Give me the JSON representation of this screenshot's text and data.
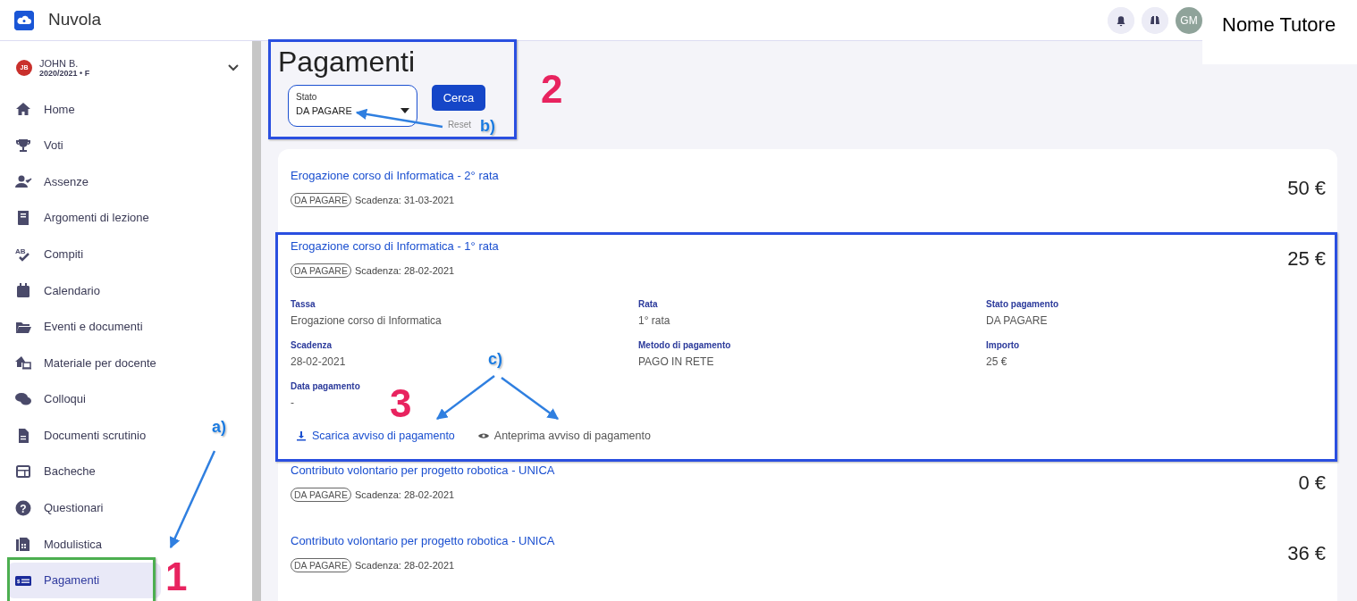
{
  "app": {
    "name": "Nuvola"
  },
  "header": {
    "avatar_initials": "GM",
    "tutor_name": "Nome Tutore"
  },
  "student": {
    "initials": "JB",
    "name": "JOHN B.",
    "subtitle": "2020/2021 • F"
  },
  "sidebar": {
    "items": [
      {
        "label": "Home",
        "selected": false
      },
      {
        "label": "Voti",
        "selected": false
      },
      {
        "label": "Assenze",
        "selected": false
      },
      {
        "label": "Argomenti di lezione",
        "selected": false
      },
      {
        "label": "Compiti",
        "icon_text": "AB",
        "selected": false
      },
      {
        "label": "Calendario",
        "selected": false
      },
      {
        "label": "Eventi e documenti",
        "selected": false
      },
      {
        "label": "Materiale per docente",
        "selected": false
      },
      {
        "label": "Colloqui",
        "selected": false
      },
      {
        "label": "Documenti scrutinio",
        "selected": false
      },
      {
        "label": "Bacheche",
        "selected": false
      },
      {
        "label": "Questionari",
        "icon_text": "?",
        "selected": false
      },
      {
        "label": "Modulistica",
        "selected": false
      },
      {
        "label": "Pagamenti",
        "icon_text": "$",
        "selected": true
      }
    ]
  },
  "page": {
    "title": "Pagamenti"
  },
  "filter": {
    "label": "Stato",
    "value": "DA PAGARE",
    "search_button": "Cerca",
    "reset": "Reset"
  },
  "payments": [
    {
      "title": "Erogazione corso di Informatica - 2° rata",
      "status": "DA PAGARE",
      "due": "Scadenza: 31-03-2021",
      "amount": "50 €",
      "expanded": false
    },
    {
      "title": "Erogazione corso di Informatica - 1° rata",
      "status": "DA PAGARE",
      "due": "Scadenza: 28-02-2021",
      "amount": "25 €",
      "expanded": true,
      "details": [
        {
          "label": "Tassa",
          "value": "Erogazione corso di Informatica"
        },
        {
          "label": "Rata",
          "value": "1° rata"
        },
        {
          "label": "Stato pagamento",
          "value": "DA PAGARE"
        },
        {
          "label": "Scadenza",
          "value": "28-02-2021"
        },
        {
          "label": "Metodo di pagamento",
          "value": "PAGO IN RETE"
        },
        {
          "label": "Importo",
          "value": "25 €"
        },
        {
          "label": "Data pagamento",
          "value": "-"
        }
      ],
      "actions": [
        {
          "kind": "download",
          "label": "Scarica avviso di pagamento"
        },
        {
          "kind": "preview",
          "label": "Anteprima avviso di pagamento"
        }
      ]
    },
    {
      "title": "Contributo volontario per progetto robotica - UNICA",
      "status": "DA PAGARE",
      "due": "Scadenza: 28-02-2021",
      "amount": "0 €",
      "expanded": false
    },
    {
      "title": "Contributo volontario per progetto robotica - UNICA",
      "status": "DA PAGARE",
      "due": "Scadenza: 28-02-2021",
      "amount": "36 €",
      "expanded": false
    }
  ],
  "annotations": [
    {
      "kind": "number",
      "text": "1"
    },
    {
      "kind": "number",
      "text": "2"
    },
    {
      "kind": "number",
      "text": "3"
    },
    {
      "kind": "callout",
      "text": "a)"
    },
    {
      "kind": "callout",
      "text": "b)"
    },
    {
      "kind": "callout",
      "text": "c)"
    }
  ]
}
